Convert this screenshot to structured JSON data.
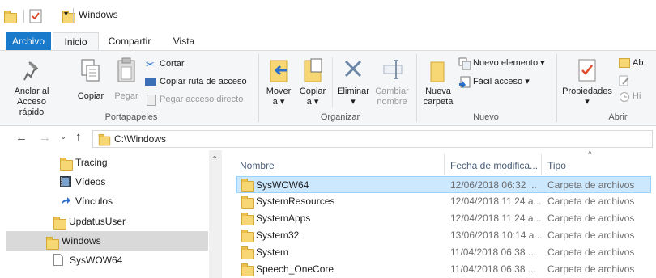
{
  "window": {
    "title": "Windows"
  },
  "ribbon_tabs": [
    "Archivo",
    "Inicio",
    "Compartir",
    "Vista"
  ],
  "clipboard": {
    "pin_label_1": "Anclar al",
    "pin_label_2": "Acceso rápido",
    "copy_label": "Copiar",
    "paste_label": "Pegar",
    "cut_label": "Cortar",
    "copy_path_label": "Copiar ruta de acceso",
    "paste_shortcut_label": "Pegar acceso directo",
    "group_label": "Portapapeles"
  },
  "organize": {
    "move_label_1": "Mover",
    "move_label_2": "a ▾",
    "copyto_label_1": "Copiar",
    "copyto_label_2": "a ▾",
    "delete_label_1": "Eliminar",
    "delete_label_2": "▾",
    "rename_label_1": "Cambiar",
    "rename_label_2": "nombre",
    "group_label": "Organizar"
  },
  "new": {
    "new_folder_label_1": "Nueva",
    "new_folder_label_2": "carpeta",
    "new_item_label": "Nuevo elemento ▾",
    "easy_access_label": "Fácil acceso ▾",
    "group_label": "Nuevo"
  },
  "open": {
    "properties_label": "Propiedades",
    "properties_arrow": "▾",
    "open_label": "Ab",
    "history_label": "Hi",
    "group_label": "Abrir"
  },
  "address": {
    "path": "C:\\Windows"
  },
  "nav_pane": {
    "items": [
      "Tracing",
      "Vídeos",
      "Vínculos",
      "UpdatusUser",
      "Windows",
      "SysWOW64"
    ]
  },
  "file_list": {
    "columns": [
      "Nombre",
      "Fecha de modifica...",
      "Tipo"
    ],
    "rows": [
      {
        "name": "SysWOW64",
        "date": "12/06/2018 06:32 ...",
        "type": "Carpeta de archivos"
      },
      {
        "name": "SystemResources",
        "date": "12/04/2018 11:24 a...",
        "type": "Carpeta de archivos"
      },
      {
        "name": "SystemApps",
        "date": "12/04/2018 11:24 a...",
        "type": "Carpeta de archivos"
      },
      {
        "name": "System32",
        "date": "13/06/2018 10:14 a...",
        "type": "Carpeta de archivos"
      },
      {
        "name": "System",
        "date": "11/04/2018 06:38 ...",
        "type": "Carpeta de archivos"
      },
      {
        "name": "Speech_OneCore",
        "date": "11/04/2018 06:38 ...",
        "type": "Carpeta de archivos"
      }
    ]
  },
  "colors": {
    "accent": "#1979ca",
    "selection": "#cce8ff",
    "folder": "#f7d774"
  }
}
